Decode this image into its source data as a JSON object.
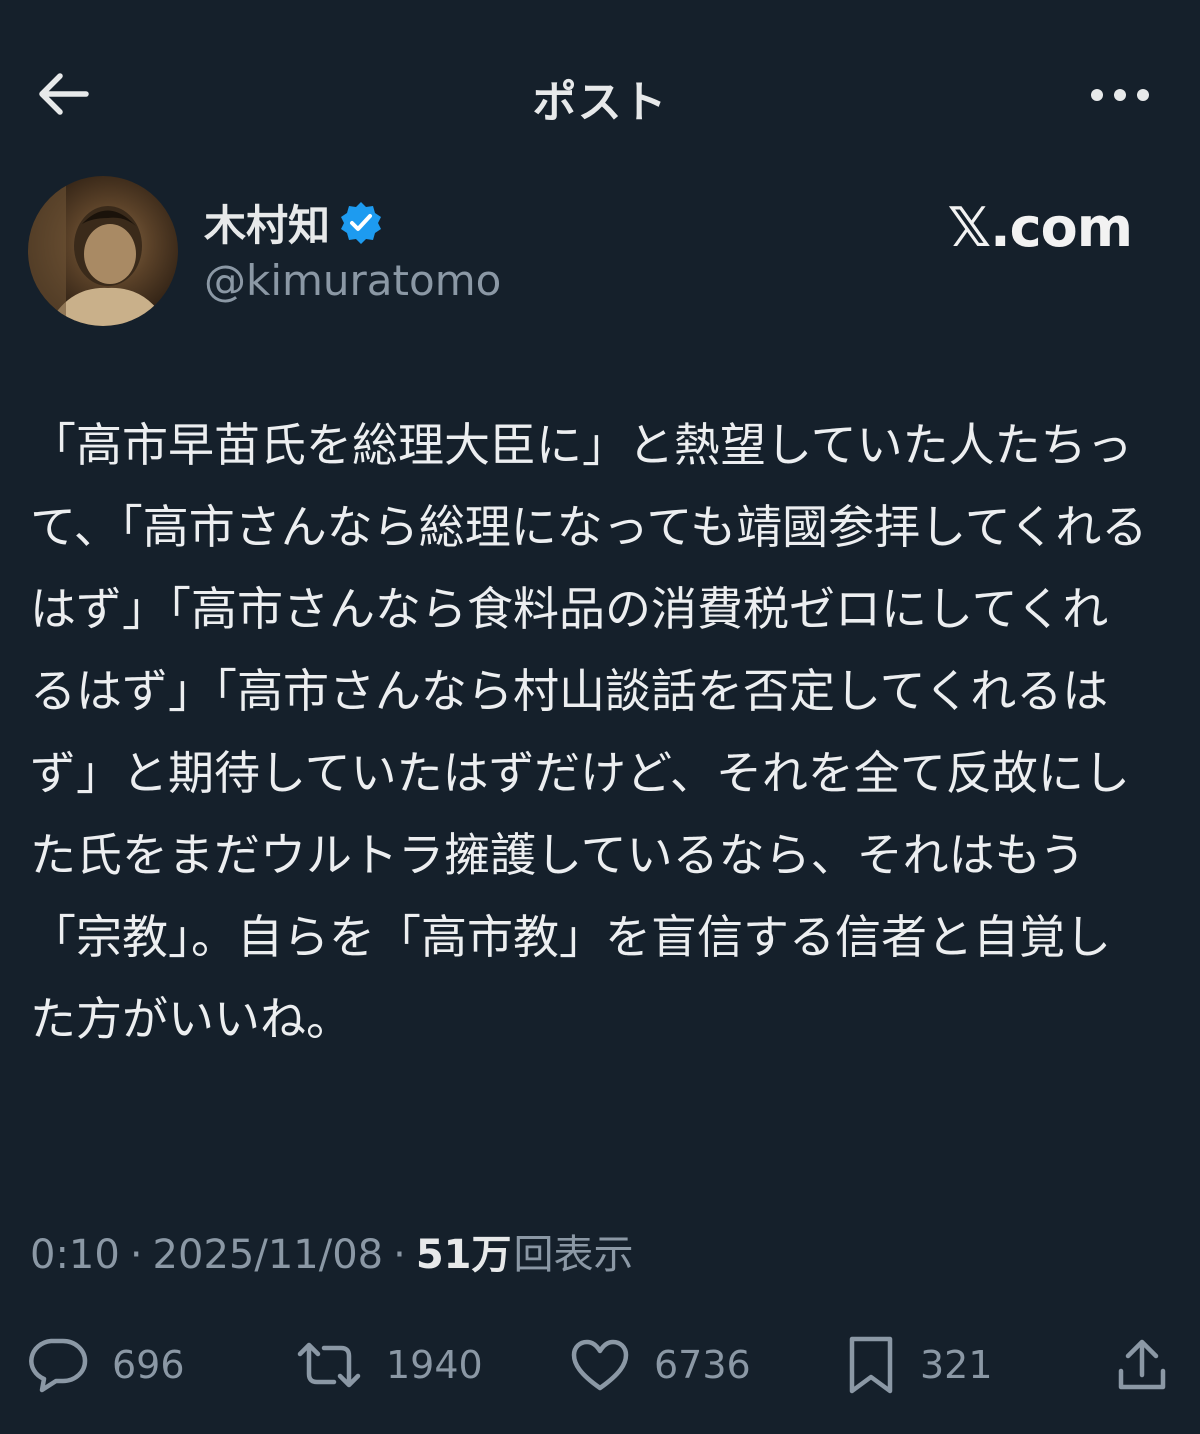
{
  "header": {
    "title": "ポスト",
    "back_icon": "arrow-left-icon",
    "more_icon": "more-horizontal-icon"
  },
  "author": {
    "name": "木村知",
    "handle": "@kimuratomo",
    "verified": true,
    "verified_color": "#1d9bf0"
  },
  "watermark": "𝕏.com",
  "post": {
    "text": "「高市早苗氏を総理大臣に」と熱望していた人たちって、「高市さんなら総理になっても靖國参拝してくれるはず」「高市さんなら食料品の消費税ゼロにしてくれるはず」「高市さんなら村山談話を否定してくれるはず」と期待していたはずだけど、それを全て反故にした氏をまだウルトラ擁護しているなら、それはもう「宗教」。自らを「高市教」を盲信する信者と自覚した方がいいね。"
  },
  "meta": {
    "time": "0:10",
    "separator": "·",
    "date": "2025/11/08",
    "views_count": "51万",
    "views_label": "回表示"
  },
  "actions": {
    "replies": "696",
    "reposts": "1940",
    "likes": "6736",
    "bookmarks": "321"
  },
  "colors": {
    "background": "#15202b",
    "text": "#e7e9ea",
    "muted": "#8b98a5"
  }
}
